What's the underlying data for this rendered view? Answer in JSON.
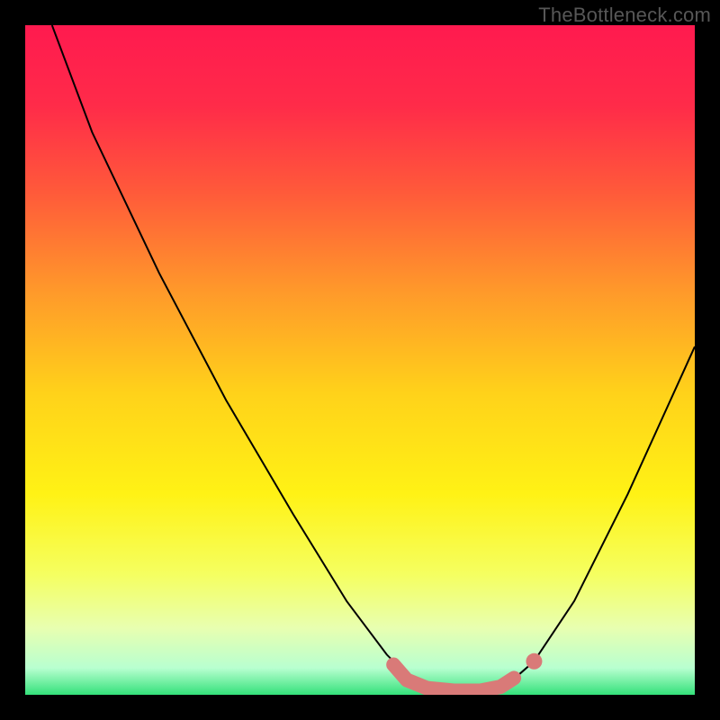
{
  "watermark": "TheBottleneck.com",
  "chart_data": {
    "type": "line",
    "title": "",
    "xlabel": "",
    "ylabel": "",
    "xlim": [
      0,
      100
    ],
    "ylim": [
      0,
      100
    ],
    "grid": false,
    "legend": false,
    "gradient_stops": [
      {
        "pos": 0.0,
        "color": "#ff1a4f"
      },
      {
        "pos": 0.12,
        "color": "#ff2b49"
      },
      {
        "pos": 0.25,
        "color": "#ff5a3a"
      },
      {
        "pos": 0.4,
        "color": "#ff9a2a"
      },
      {
        "pos": 0.55,
        "color": "#ffd21a"
      },
      {
        "pos": 0.7,
        "color": "#fff215"
      },
      {
        "pos": 0.82,
        "color": "#f5ff60"
      },
      {
        "pos": 0.9,
        "color": "#e8ffb0"
      },
      {
        "pos": 0.96,
        "color": "#b8ffd0"
      },
      {
        "pos": 1.0,
        "color": "#34e17a"
      }
    ],
    "series": [
      {
        "name": "bottleneck-curve",
        "stroke": "#000000",
        "stroke_width": 2,
        "points": [
          {
            "x": 4.0,
            "y": 100.0
          },
          {
            "x": 10.0,
            "y": 84.0
          },
          {
            "x": 20.0,
            "y": 63.0
          },
          {
            "x": 30.0,
            "y": 44.0
          },
          {
            "x": 40.0,
            "y": 27.0
          },
          {
            "x": 48.0,
            "y": 14.0
          },
          {
            "x": 54.0,
            "y": 6.0
          },
          {
            "x": 58.0,
            "y": 2.0
          },
          {
            "x": 63.0,
            "y": 0.5
          },
          {
            "x": 68.0,
            "y": 0.5
          },
          {
            "x": 72.0,
            "y": 1.5
          },
          {
            "x": 76.0,
            "y": 5.0
          },
          {
            "x": 82.0,
            "y": 14.0
          },
          {
            "x": 90.0,
            "y": 30.0
          },
          {
            "x": 100.0,
            "y": 52.0
          }
        ]
      },
      {
        "name": "optimal-band",
        "stroke": "#d97a78",
        "stroke_width": 16,
        "linecap": "round",
        "points": [
          {
            "x": 55.0,
            "y": 4.5
          },
          {
            "x": 57.0,
            "y": 2.2
          },
          {
            "x": 60.0,
            "y": 1.0
          },
          {
            "x": 64.0,
            "y": 0.6
          },
          {
            "x": 68.0,
            "y": 0.6
          },
          {
            "x": 71.0,
            "y": 1.2
          },
          {
            "x": 73.0,
            "y": 2.5
          }
        ]
      },
      {
        "name": "marker-dot",
        "type": "scatter",
        "fill": "#d97a78",
        "radius": 9,
        "points": [
          {
            "x": 76.0,
            "y": 5.0
          }
        ]
      }
    ]
  }
}
